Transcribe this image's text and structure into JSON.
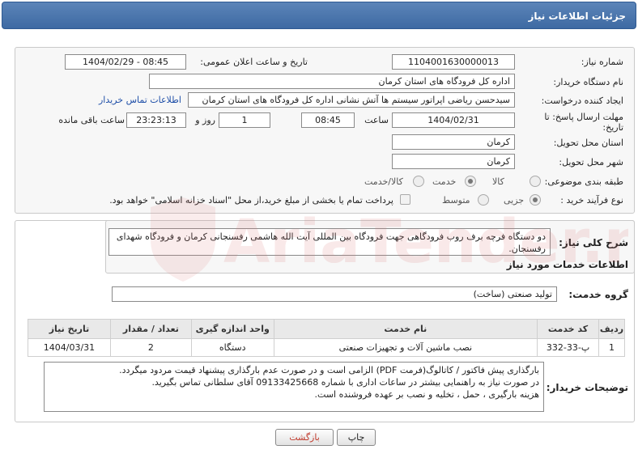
{
  "header": {
    "title": "جزئیات اطلاعات نیاز"
  },
  "form": {
    "need_number_label": "شماره نیاز:",
    "need_number": "1104001630000013",
    "announce_label": "تاریخ و ساعت اعلان عمومی:",
    "announce_value": "1404/02/29 - 08:45",
    "buyer_org_label": "نام دستگاه خریدار:",
    "buyer_org": "اداره کل فرودگاه های استان کرمان",
    "requester_label": "ایجاد کننده درخواست:",
    "requester": "سیدحسن ریاضی اپراتور سیستم ها آتش نشانی اداره کل فرودگاه های استان کرمان",
    "contact_link": "اطلاعات تماس خریدار",
    "deadline_label": "مهلت ارسال پاسخ: تا تاریخ:",
    "deadline_date": "1404/02/31",
    "time_label": "ساعت",
    "deadline_time": "08:45",
    "days_value": "1",
    "days_label": "روز و",
    "remaining_time": "23:23:13",
    "remaining_label": "ساعت باقی مانده",
    "province_label": "استان محل تحویل:",
    "province": "کرمان",
    "city_label": "شهر محل تحویل:",
    "city": "کرمان",
    "category_label": "طبقه بندی موضوعی:",
    "category_options": [
      "کالا",
      "خدمت",
      "کالا/خدمت"
    ],
    "process_label": "نوع فرآیند خرید :",
    "process_options": [
      "جزیی",
      "متوسط"
    ],
    "payment_note": "پرداخت تمام یا بخشی از مبلغ خرید،از محل \"اسناد خزانه اسلامی\" خواهد بود."
  },
  "summary": {
    "label": "شرح کلی نیاز:",
    "text": "دو دستگاه فرچه برف روب فرودگاهی جهت فرودگاه بین المللی آیت الله هاشمی رفسنجانی کرمان و فرودگاه شهدای رفسنجان."
  },
  "services": {
    "section_title": "اطلاعات خدمات مورد نیاز",
    "group_label": "گروه خدمت:",
    "group_value": "تولید صنعتی (ساخت)",
    "columns": [
      "ردیف",
      "کد خدمت",
      "نام خدمت",
      "واحد اندازه گیری",
      "تعداد / مقدار",
      "تاریخ نیاز"
    ],
    "rows": [
      [
        "1",
        "پ-33-332",
        "نصب ماشین آلات و تجهیزات صنعتی",
        "دستگاه",
        "2",
        "1404/03/31"
      ]
    ]
  },
  "buyer_notes": {
    "label": "توضیحات خریدار:",
    "lines": [
      "بارگذاری پیش فاکتور / کاتالوگ(فرمت PDF) الزامی است و در صورت عدم بارگذاری پیشنهاد قیمت مردود میگردد.",
      "در صورت نیاز به راهنمایی بیشتر در ساعات اداری با شماره 09133425668 آقای سلطانی  تماس بگیرید.",
      "هزینه بارگیری ، حمل ، تخلیه و نصب بر عهده فروشنده است."
    ]
  },
  "buttons": {
    "print": "چاپ",
    "back": "بازگشت"
  },
  "watermark": {
    "text": "AriaTender.net"
  },
  "colors": {
    "header": "#4a75ad",
    "link": "#1f4fa8",
    "back_button_text": "#c0392b"
  }
}
